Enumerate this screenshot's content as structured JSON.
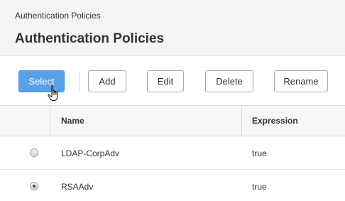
{
  "header": {
    "breadcrumb": "Authentication Policies",
    "title": "Authentication Policies"
  },
  "toolbar": {
    "buttons": [
      {
        "label": "Select"
      },
      {
        "label": "Add"
      },
      {
        "label": "Edit"
      },
      {
        "label": "Delete"
      },
      {
        "label": "Rename"
      }
    ]
  },
  "table": {
    "columns": [
      "Name",
      "Expression"
    ],
    "rows": [
      {
        "name": "LDAP-CorpAdv",
        "expression": "true",
        "selected": false
      },
      {
        "name": "RSAAdv",
        "expression": "true",
        "selected": true
      }
    ]
  },
  "colors": {
    "accent": "#5aa0e6",
    "header_bg": "#f4f4f4"
  },
  "icons": {
    "cursor": "hand-pointer-icon"
  }
}
